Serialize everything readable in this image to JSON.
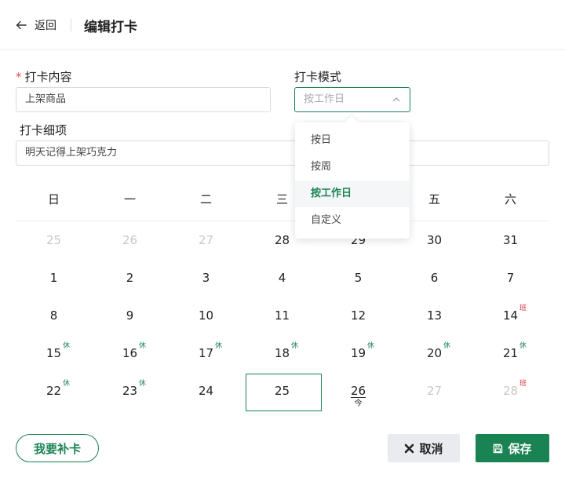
{
  "header": {
    "back_label": "返回",
    "title": "编辑打卡"
  },
  "form": {
    "content_required": "*",
    "content_label": "打卡内容",
    "content_value": "上架商品",
    "mode_label": "打卡模式",
    "mode_placeholder": "按工作日",
    "detail_label": "打卡细项",
    "detail_value": "明天记得上架巧克力"
  },
  "dropdown": {
    "options": [
      "按日",
      "按周",
      "按工作日",
      "自定义"
    ],
    "selected": "按工作日"
  },
  "calendar": {
    "weekdays": [
      "日",
      "一",
      "二",
      "三",
      "四",
      "五",
      "六"
    ],
    "today_label": "今",
    "rest_badge": "休",
    "work_badge": "班",
    "days": [
      {
        "n": "25",
        "muted": true
      },
      {
        "n": "26",
        "muted": true
      },
      {
        "n": "27",
        "muted": true
      },
      {
        "n": "28"
      },
      {
        "n": "29"
      },
      {
        "n": "30"
      },
      {
        "n": "31"
      },
      {
        "n": "1"
      },
      {
        "n": "2"
      },
      {
        "n": "3"
      },
      {
        "n": "4"
      },
      {
        "n": "5"
      },
      {
        "n": "6"
      },
      {
        "n": "7"
      },
      {
        "n": "8"
      },
      {
        "n": "9"
      },
      {
        "n": "10"
      },
      {
        "n": "11"
      },
      {
        "n": "12"
      },
      {
        "n": "13"
      },
      {
        "n": "14",
        "badge": "work"
      },
      {
        "n": "15",
        "badge": "rest"
      },
      {
        "n": "16",
        "badge": "rest"
      },
      {
        "n": "17",
        "badge": "rest"
      },
      {
        "n": "18",
        "badge": "rest"
      },
      {
        "n": "19",
        "badge": "rest"
      },
      {
        "n": "20",
        "badge": "rest"
      },
      {
        "n": "21",
        "badge": "rest"
      },
      {
        "n": "22",
        "badge": "rest"
      },
      {
        "n": "23",
        "badge": "rest"
      },
      {
        "n": "24"
      },
      {
        "n": "25",
        "selected": true
      },
      {
        "n": "26",
        "today": true
      },
      {
        "n": "27",
        "muted": true
      },
      {
        "n": "28",
        "muted": true,
        "badge": "work"
      }
    ]
  },
  "buttons": {
    "makeup": "我要补卡",
    "cancel": "取消",
    "save": "保存"
  },
  "colors": {
    "accent": "#1a8354",
    "rest": "#1a8354",
    "work": "#d9363e",
    "muted_text": "#c8c8c8"
  }
}
